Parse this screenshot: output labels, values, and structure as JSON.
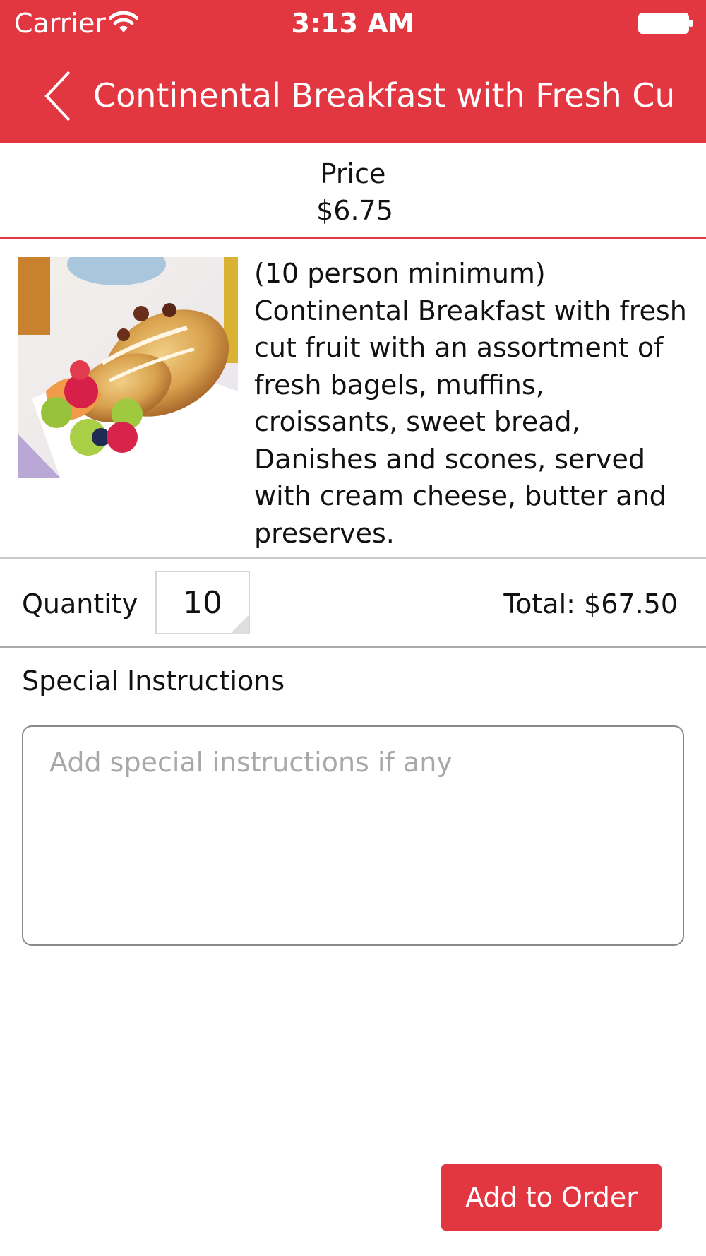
{
  "status_bar": {
    "carrier": "Carrier",
    "time": "3:13 AM",
    "wifi_icon": "wifi-icon",
    "battery_icon": "battery-icon"
  },
  "nav": {
    "back_icon": "chevron-left-icon",
    "title": "Continental Breakfast with Fresh Cut···"
  },
  "price": {
    "label": "Price",
    "value": "$6.75"
  },
  "product": {
    "image": "breakfast-pastry-fruit-image",
    "description": "(10 person minimum) Continental Breakfast with fresh cut fruit with an assortment of fresh bagels, muffins, croissants, sweet bread, Danishes and scones, served with cream cheese, butter and preserves."
  },
  "order": {
    "quantity_label": "Quantity",
    "quantity_value": "10",
    "total": "Total: $67.50"
  },
  "special_instructions": {
    "label": "Special Instructions",
    "placeholder": "Add special instructions if any",
    "value": ""
  },
  "actions": {
    "add_to_order_label": "Add to Order"
  },
  "colors": {
    "accent": "#e23641",
    "background": "#ffffff",
    "placeholder_text": "#a8a8a8"
  }
}
